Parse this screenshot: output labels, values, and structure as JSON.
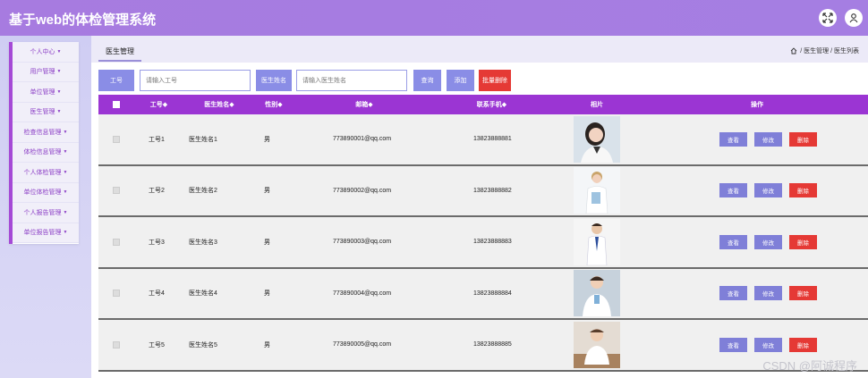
{
  "app": {
    "title": "基于web的体检管理系统"
  },
  "topbar": {
    "fullscreen_icon": "fullscreen-icon",
    "user_icon": "user-icon"
  },
  "sidebar": {
    "items": [
      {
        "label": "个人中心"
      },
      {
        "label": "用户管理"
      },
      {
        "label": "单位管理"
      },
      {
        "label": "医生管理"
      },
      {
        "label": "检查信息管理"
      },
      {
        "label": "体检信息管理"
      },
      {
        "label": "个人体检管理"
      },
      {
        "label": "单位体检管理"
      },
      {
        "label": "个人报告管理"
      },
      {
        "label": "单位报告管理"
      }
    ]
  },
  "breadcrumb": {
    "tab": "医生管理",
    "path": "/ 医生管理 / 医生列表",
    "home_icon": "home-icon"
  },
  "search": {
    "no_label": "工号",
    "no_placeholder": "请输入工号",
    "name_label": "医生姓名",
    "name_placeholder": "请输入医生姓名",
    "query_button": "查询",
    "add_button": "添加",
    "batch_delete_button": "批量删除"
  },
  "table": {
    "headers": [
      "工号◆",
      "医生姓名◆",
      "性别◆",
      "邮箱◆",
      "联系手机◆",
      "相片",
      "操作"
    ],
    "rows": [
      {
        "no": "工号1",
        "name": "医生姓名1",
        "sex": "男",
        "email": "773890001@qq.com",
        "phone": "13823888881"
      },
      {
        "no": "工号2",
        "name": "医生姓名2",
        "sex": "男",
        "email": "773890002@qq.com",
        "phone": "13823888882"
      },
      {
        "no": "工号3",
        "name": "医生姓名3",
        "sex": "男",
        "email": "773890003@qq.com",
        "phone": "13823888883"
      },
      {
        "no": "工号4",
        "name": "医生姓名4",
        "sex": "男",
        "email": "773890004@qq.com",
        "phone": "13823888884"
      },
      {
        "no": "工号5",
        "name": "医生姓名5",
        "sex": "男",
        "email": "773890005@qq.com",
        "phone": "13823888885"
      }
    ],
    "ops": {
      "view": "查看",
      "edit": "修改",
      "delete": "删除"
    }
  },
  "watermark": "CSDN @阿诚程序",
  "colors": {
    "accent": "#9b35d3",
    "header_bar": "#a77be0",
    "button": "#8a8de6",
    "danger": "#e53935"
  }
}
